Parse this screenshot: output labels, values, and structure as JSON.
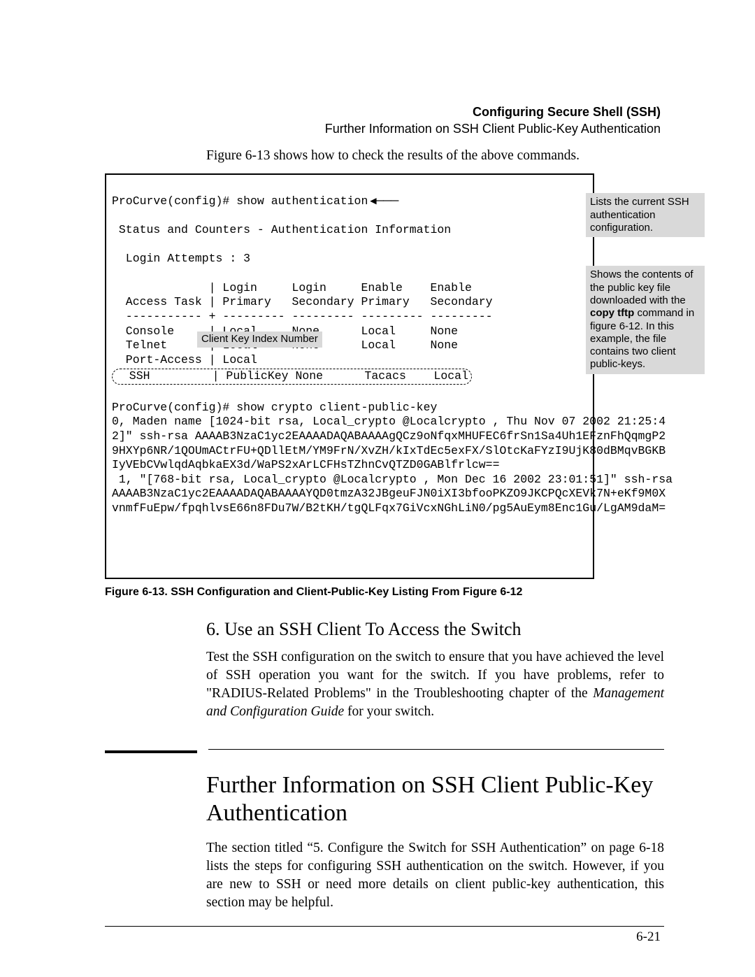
{
  "header": {
    "title": "Configuring Secure Shell (SSH)",
    "subtitle": "Further Information on SSH Client Public-Key Authentication"
  },
  "intro": "Figure 6-13 shows how to check the results of the above commands.",
  "figure": {
    "line1": "ProCurve(config)# show authentication",
    "status": " Status and Counters - Authentication Information",
    "attempts": "  Login Attempts : 3",
    "hdr1": "              | Login     Login     Enable    Enable",
    "hdr2": "  Access Task | Primary   Secondary Primary   Secondary",
    "divider": "  ----------- + --------- --------- --------- ---------",
    "row_console": "  Console     | Local     None      Local     None",
    "row_telnet": "  Telnet      | Local     None      Local     None",
    "row_port": "  Port-Access | Local",
    "row_ssh": "  SSH         | PublicKey None      Tacacs    Local",
    "cmd2_space": " ",
    "cmd2": "ProCurve(config)# show crypto client-public-key",
    "k1": "0, Maden name [1024-bit rsa, Local_crypto @Localcrypto , Thu Nov 07 2002 21:25:4",
    "k2": "2]\" ssh-rsa AAAAB3NzaC1yc2EAAAADAQABAAAAgQCz9oNfqxMHUFEC6frSn1Sa4Uh1EFznFhQqmgP2",
    "k3": "9HXYp6NR/1QOUmACtrFU+QDllEtM/YM9FrN/XvZH/kIxTdEc5exFX/SlOtcKaFYzI9UjK80dBMqvBGKB",
    "k4": "IyVEbCVwlqdAqbkaEX3d/WaPS2xArLCFHsTZhnCvQTZD0GABlfrlcw==",
    "k5": " 1, \"[768-bit rsa, Local_crypto @Localcrypto , Mon Dec 16 2002 23:01:51]\" ssh-rsa",
    "k6": "AAAAB3NzaC1yc2EAAAADAQABAAAAYQD0tmzA32JBgeuFJN0iXI3bfooPKZO9JKCPQcXEVk7N+eKf9M0X",
    "k7": "vnmfFuEpw/fpqhlvsE66n8FDu7W/B2tKH/tgQLFqx7GiVcxNGhLiN0/pg5AuEym8Enc1Gu/LgAM9daM=",
    "callout1": "Lists the current SSH authentication configuration.",
    "callout2_pre": "Shows the contents of the public key file downloaded with the ",
    "callout2_bold": "copy tftp",
    "callout2_post": " command in figure 6-12. In this example, the file contains two client public-keys.",
    "index_label": "Client Key Index Number",
    "caption": "Figure 6-13. SSH Configuration and Client-Public-Key Listing From Figure 6-12"
  },
  "section6": {
    "heading": "6. Use an SSH Client To Access the Switch",
    "para_plain": "Test the SSH configuration on the switch to ensure that you have achieved the level of SSH operation you want for the switch. If you have problems, refer to \"RADIUS-Related Problems\" in the Troubleshooting chapter of the ",
    "para_ital": "Management and Configuration Guide",
    "para_tail": " for your switch."
  },
  "sectionMain": {
    "heading": "Further Information on SSH Client Public-Key Authentication",
    "para": "The section titled “5. Configure the Switch for SSH Authentication” on page 6-18 lists the steps for configuring SSH authentication on the switch. However, if you are new to SSH or need more details on client public-key authentication, this section may be helpful."
  },
  "page_number": "6-21"
}
